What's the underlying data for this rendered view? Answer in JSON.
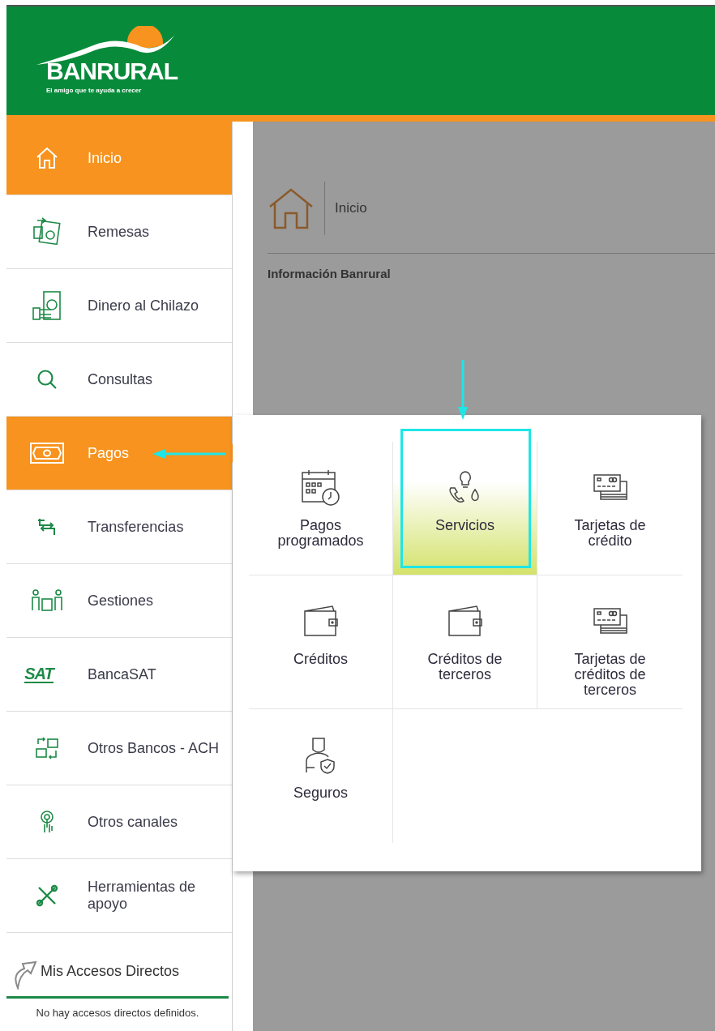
{
  "header": {
    "brand": "BANRURAL",
    "tagline": "El amigo que te ayuda a crecer"
  },
  "sidebar": {
    "items": [
      {
        "label": "Inicio",
        "selected": true
      },
      {
        "label": "Remesas",
        "selected": false
      },
      {
        "label": "Dinero al Chilazo",
        "selected": false
      },
      {
        "label": "Consultas",
        "selected": false
      },
      {
        "label": "Pagos",
        "selected": true,
        "expanded": true
      },
      {
        "label": "Transferencias",
        "selected": false
      },
      {
        "label": "Gestiones",
        "selected": false
      },
      {
        "label": "BancaSAT",
        "selected": false,
        "badge": "SAT"
      },
      {
        "label": "Otros Bancos - ACH",
        "selected": false
      },
      {
        "label": "Otros canales",
        "selected": false
      },
      {
        "label": "Herramientas de apoyo",
        "selected": false
      }
    ],
    "shortcuts": {
      "title": "Mis Accesos Directos",
      "empty_message": "No hay accesos directos definidos."
    }
  },
  "breadcrumb": {
    "label": "Inicio"
  },
  "section_title": "Información Banrural",
  "submenu": {
    "items": [
      {
        "label": "Pagos programados",
        "selected": false
      },
      {
        "label": "Servicios",
        "selected": true
      },
      {
        "label": "Tarjetas de crédito",
        "selected": false
      },
      {
        "label": "Créditos",
        "selected": false
      },
      {
        "label": "Créditos de terceros",
        "selected": false
      },
      {
        "label": "Tarjetas de créditos de terceros",
        "selected": false
      },
      {
        "label": "Seguros",
        "selected": false
      }
    ]
  }
}
